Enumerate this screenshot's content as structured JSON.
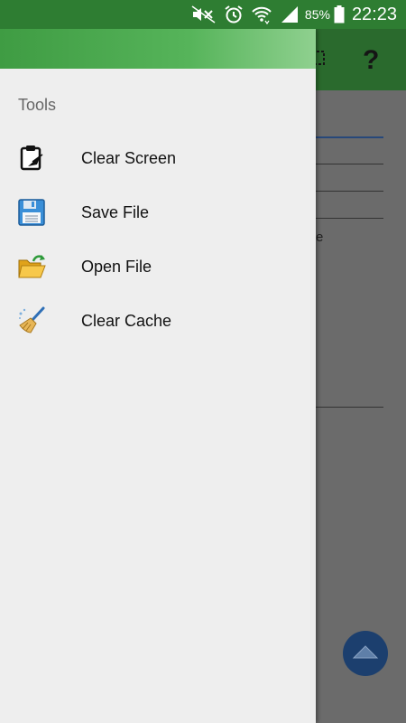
{
  "status_bar": {
    "icons": [
      "mute-icon",
      "alarm-icon",
      "wifi-icon",
      "signal-icon"
    ],
    "battery_percent": "85%",
    "time": "22:23"
  },
  "background_app": {
    "toolbar_icons": [
      "screen-icon",
      "help-icon"
    ],
    "help_glyph": "?",
    "partial_text": "e"
  },
  "drawer": {
    "section_title": "Tools",
    "items": [
      {
        "label": "Clear Screen",
        "icon": "clipboard-icon"
      },
      {
        "label": "Save File",
        "icon": "floppy-disk-icon"
      },
      {
        "label": "Open File",
        "icon": "open-folder-icon"
      },
      {
        "label": "Clear Cache",
        "icon": "broom-icon"
      }
    ]
  },
  "colors": {
    "status_bar": "#2e7d32",
    "drawer_background": "#eeeeee",
    "scrim": "#6b6b6b",
    "fab": "#1c3f6e"
  }
}
